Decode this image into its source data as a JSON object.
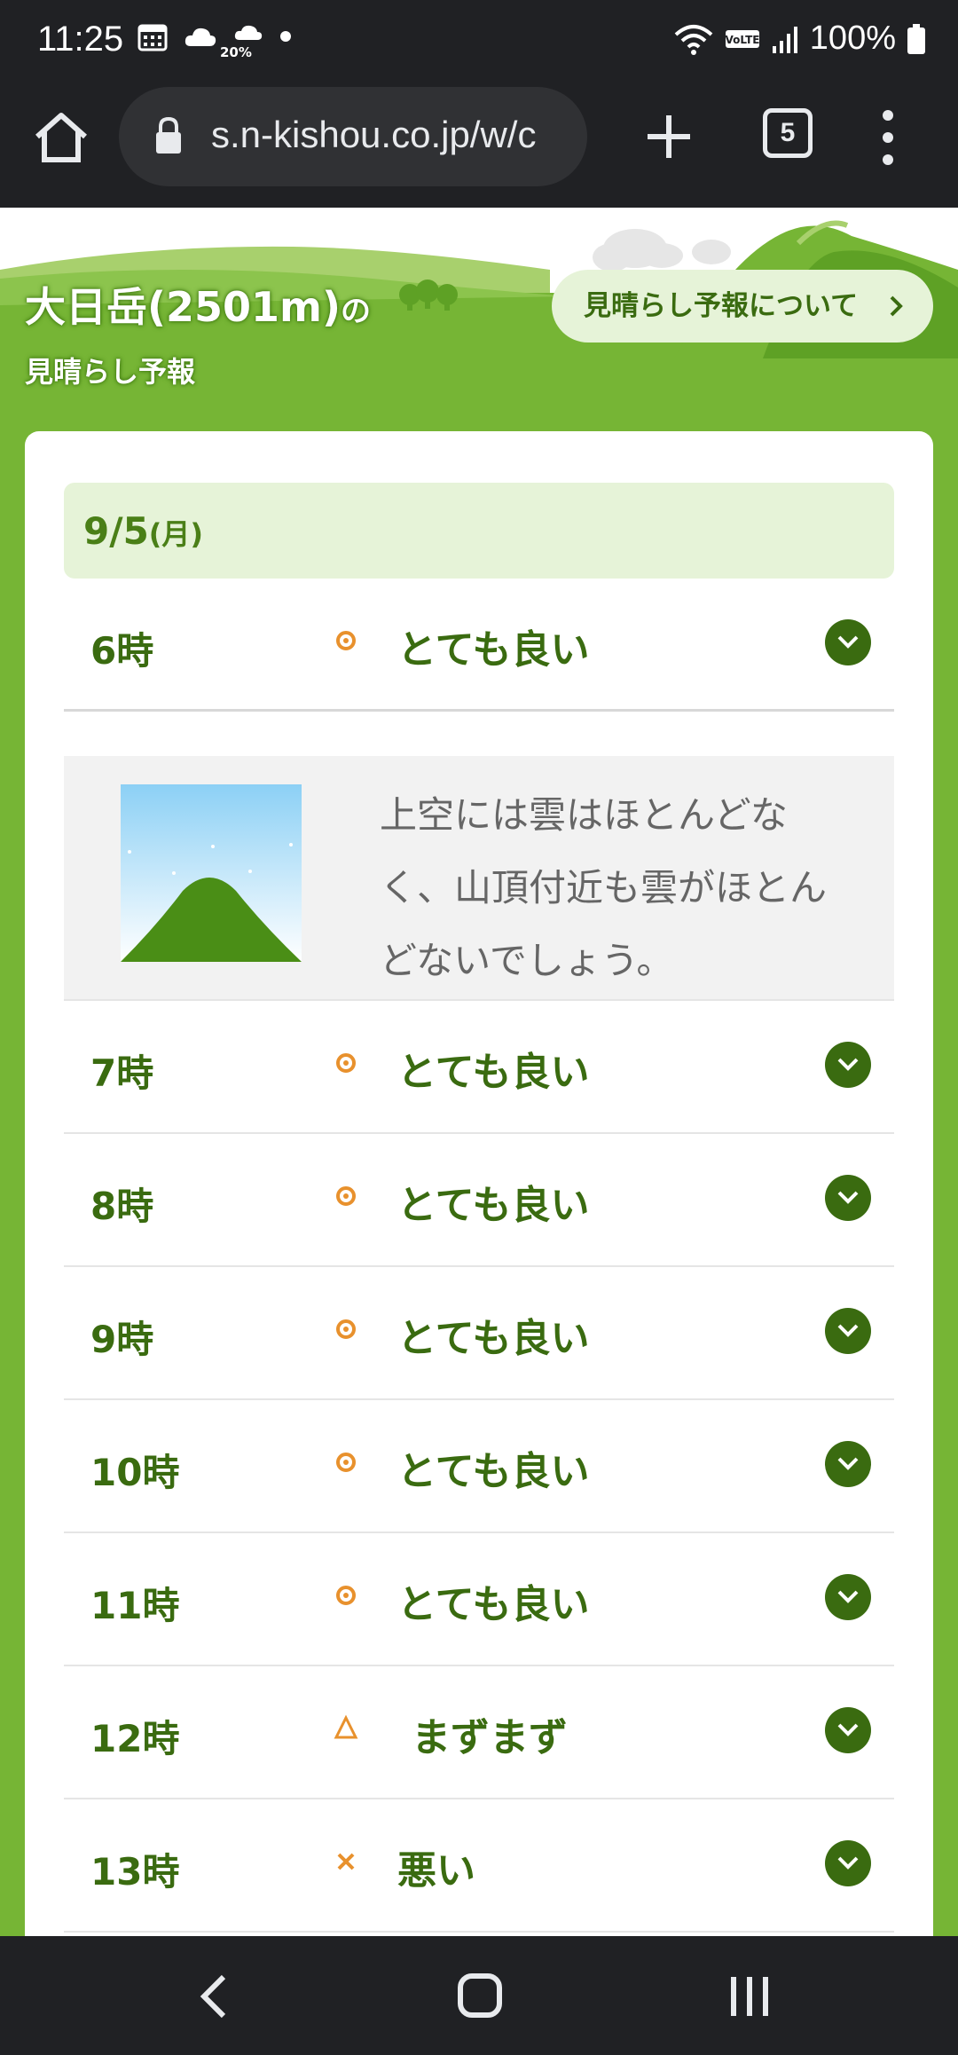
{
  "status_bar": {
    "time": "11:25",
    "rain_chance": "20%",
    "battery": "100%"
  },
  "browser": {
    "url": "s.n-kishou.co.jp/w/c",
    "tab_count": "5"
  },
  "hero": {
    "mountain_name": "大日岳(2501m)",
    "title_suffix": "の",
    "subtitle": "見晴らし予報",
    "about_link": "見晴らし予報について"
  },
  "forecast": {
    "date": "9/5",
    "day": "(月)",
    "rows": [
      {
        "hour": "6時",
        "symbol": "circle",
        "rating": "とても良い",
        "expanded": true
      },
      {
        "hour": "7時",
        "symbol": "circle",
        "rating": "とても良い"
      },
      {
        "hour": "8時",
        "symbol": "circle",
        "rating": "とても良い"
      },
      {
        "hour": "9時",
        "symbol": "circle",
        "rating": "とても良い"
      },
      {
        "hour": "10時",
        "symbol": "circle",
        "rating": "とても良い"
      },
      {
        "hour": "11時",
        "symbol": "circle",
        "rating": "とても良い"
      },
      {
        "hour": "12時",
        "symbol": "triangle",
        "rating": "まずまず"
      },
      {
        "hour": "13時",
        "symbol": "cross",
        "rating": "悪い"
      }
    ],
    "detail": {
      "line1": "上空には雲はほとんどな",
      "line2": "く、山頂付近も雲がほとん",
      "line3": "どないでしょう。"
    }
  },
  "colors": {
    "accent_green": "#76b535",
    "dark_green": "#3a6b10",
    "symbol_orange": "#e8912d"
  }
}
